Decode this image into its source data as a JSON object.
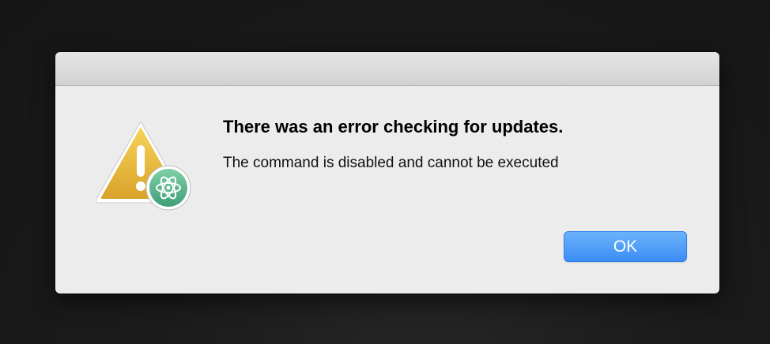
{
  "dialog": {
    "title": "There was an error checking for updates.",
    "message": "The command is disabled and cannot be executed",
    "ok_label": "OK"
  },
  "icons": {
    "alert": "warning-triangle-icon",
    "badge": "atom-app-icon"
  },
  "colors": {
    "button_top": "#6cb2fb",
    "button_bottom": "#3b8ef5",
    "warning_yellow": "#e9b93c",
    "badge_green": "#5cb890"
  }
}
